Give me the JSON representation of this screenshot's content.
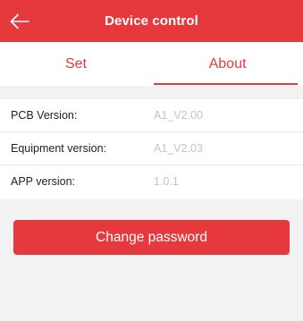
{
  "header": {
    "title": "Device control",
    "back_icon": "arrow-left-icon"
  },
  "tabs": [
    {
      "label": "Set",
      "active": false
    },
    {
      "label": "About",
      "active": true
    }
  ],
  "info": {
    "rows": [
      {
        "label": "PCB Version:",
        "value": "A1_V2.00"
      },
      {
        "label": "Equipment version:",
        "value": "A1_V2.03"
      },
      {
        "label": "APP version:",
        "value": "1.0.1"
      }
    ]
  },
  "actions": {
    "change_password_label": "Change password"
  },
  "colors": {
    "accent": "#e5393d",
    "background": "#f2f2f2",
    "value_text": "#c4c4c4"
  }
}
